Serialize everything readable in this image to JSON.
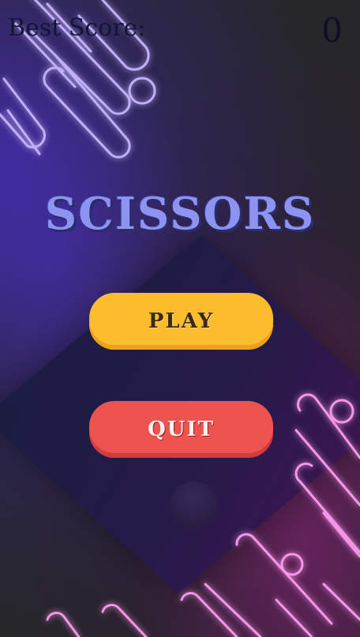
{
  "header": {
    "best_score_label": "Best Score:",
    "score_value": "0"
  },
  "title": "SCISSORS",
  "menu": {
    "play_label": "PLAY",
    "quit_label": "QUIT"
  },
  "colors": {
    "title": "#8c93f0",
    "play_button": "#fbbd2b",
    "quit_button": "#ef5350",
    "neon_top": "#8a6cff",
    "neon_bottom": "#ff3fe0"
  }
}
